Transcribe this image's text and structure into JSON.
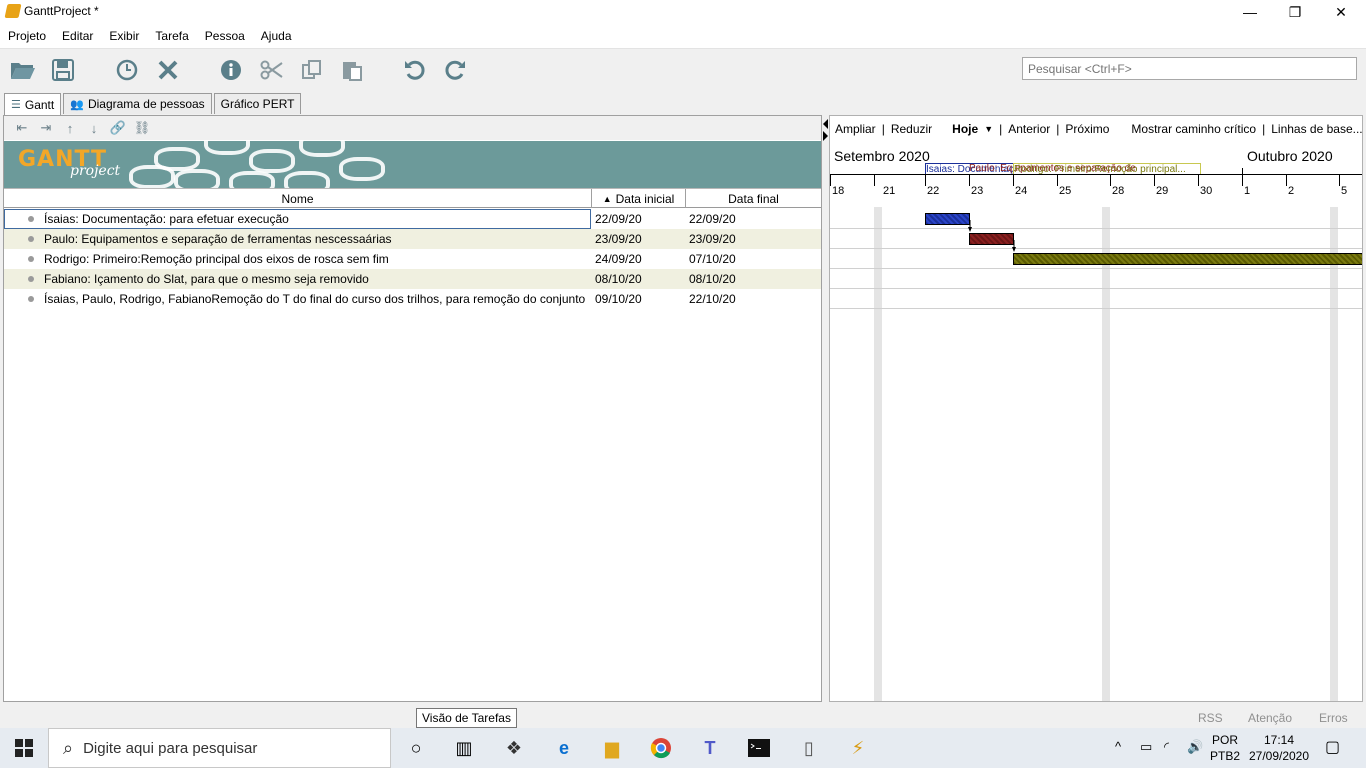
{
  "window": {
    "title": "GanttProject *",
    "minimize": "—",
    "restore": "❐",
    "close": "✕"
  },
  "menu": [
    "Projeto",
    "Editar",
    "Exibir",
    "Tarefa",
    "Pessoa",
    "Ajuda"
  ],
  "search": {
    "placeholder": "Pesquisar <Ctrl+F>"
  },
  "tabs": [
    {
      "label": "Gantt",
      "active": true
    },
    {
      "label": "Diagrama de pessoas",
      "active": false
    },
    {
      "label": "Gráfico PERT",
      "active": false
    }
  ],
  "banner": {
    "logo_text": "GANTT",
    "logo_sub": "project"
  },
  "table": {
    "columns": [
      "Nome",
      "Data inicial",
      "Data final"
    ],
    "sort_indicator": "▲",
    "rows": [
      {
        "name": "Ísaias: Documentação: para efetuar execução",
        "start": "22/09/20",
        "end": "22/09/20"
      },
      {
        "name": "Paulo: Equipamentos e separação de ferramentas nescessaárias",
        "start": "23/09/20",
        "end": "23/09/20"
      },
      {
        "name": "Rodrigo: Primeiro:Remoção principal dos eixos de rosca sem fim",
        "start": "24/09/20",
        "end": "07/10/20"
      },
      {
        "name": "Fabiano: Içamento do Slat, para que o mesmo seja removido",
        "start": "08/10/20",
        "end": "08/10/20"
      },
      {
        "name": "Ísaias, Paulo, Rodrigo, FabianoRemoção do T do final do curso dos trilhos, para remoção do conjunto",
        "start": "09/10/20",
        "end": "22/10/20"
      }
    ]
  },
  "chart": {
    "nav": {
      "zoom_in": "Ampliar",
      "zoom_out": "Reduzir",
      "today": "Hoje",
      "prev": "Anterior",
      "next": "Próximo",
      "critical": "Mostrar caminho crítico",
      "baselines": "Linhas de base..."
    },
    "months": [
      "Setembro 2020",
      "Outubro 2020"
    ],
    "days": [
      "18",
      "21",
      "22",
      "23",
      "24",
      "25",
      "28",
      "29",
      "30",
      "1",
      "2",
      "5"
    ],
    "task_labels": [
      "Ísaias: Documentaç",
      "Paulo: Equipamentos e separação de",
      "Rodrigo: Primeiro:Remoção principal..."
    ]
  },
  "status": {
    "tooltip": "Visão de Tarefas",
    "rss": "RSS",
    "attention": "Atenção",
    "errors": "Erros"
  },
  "taskbar": {
    "search_placeholder": "Digite aqui para pesquisar",
    "lang1": "POR",
    "lang2": "PTB2",
    "time": "17:14",
    "date": "27/09/2020"
  }
}
